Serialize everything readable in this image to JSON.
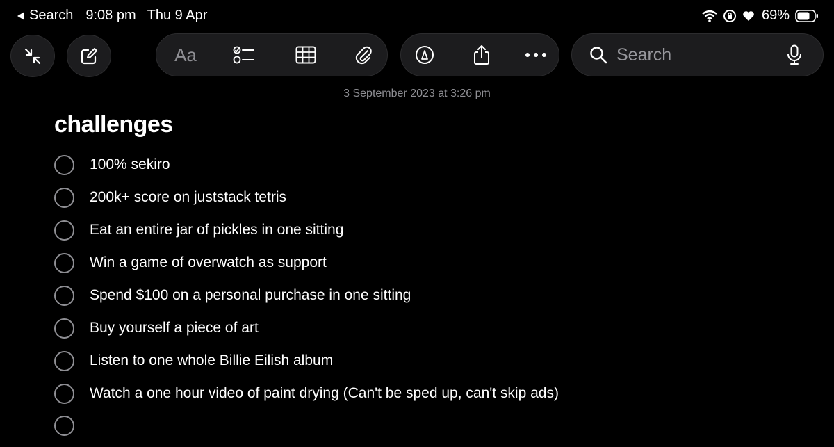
{
  "status_bar": {
    "back_label": "Search",
    "time": "9:08 pm",
    "date": "Thu 9 Apr",
    "battery": "69%"
  },
  "toolbar": {
    "format_label": "Aa",
    "search_placeholder": "Search",
    "icons": [
      "collapse-icon",
      "compose-icon",
      "checklist-icon",
      "table-icon",
      "paperclip-icon",
      "markup-icon",
      "share-icon",
      "more-icon",
      "search-icon",
      "microphone-icon"
    ]
  },
  "note": {
    "timestamp": "3 September 2023 at 3:26 pm",
    "title": "challenges",
    "items": [
      {
        "text": "100% sekiro",
        "checked": false
      },
      {
        "text": "200k+ score on juststack tetris",
        "checked": false
      },
      {
        "text": "Eat an entire jar of pickles in one sitting",
        "checked": false
      },
      {
        "text": "Win a game of overwatch as support",
        "checked": false
      },
      {
        "text_before": "Spend ",
        "link": "$100",
        "text_after": " on a personal purchase in one sitting",
        "checked": false
      },
      {
        "text": "Buy yourself a piece of art",
        "checked": false
      },
      {
        "text": "Listen to one whole Billie Eilish album",
        "checked": false
      },
      {
        "text": "Watch a one hour video of paint drying (Can't be sped up, can't skip ads)",
        "checked": false
      },
      {
        "text": "",
        "checked": false
      }
    ]
  }
}
